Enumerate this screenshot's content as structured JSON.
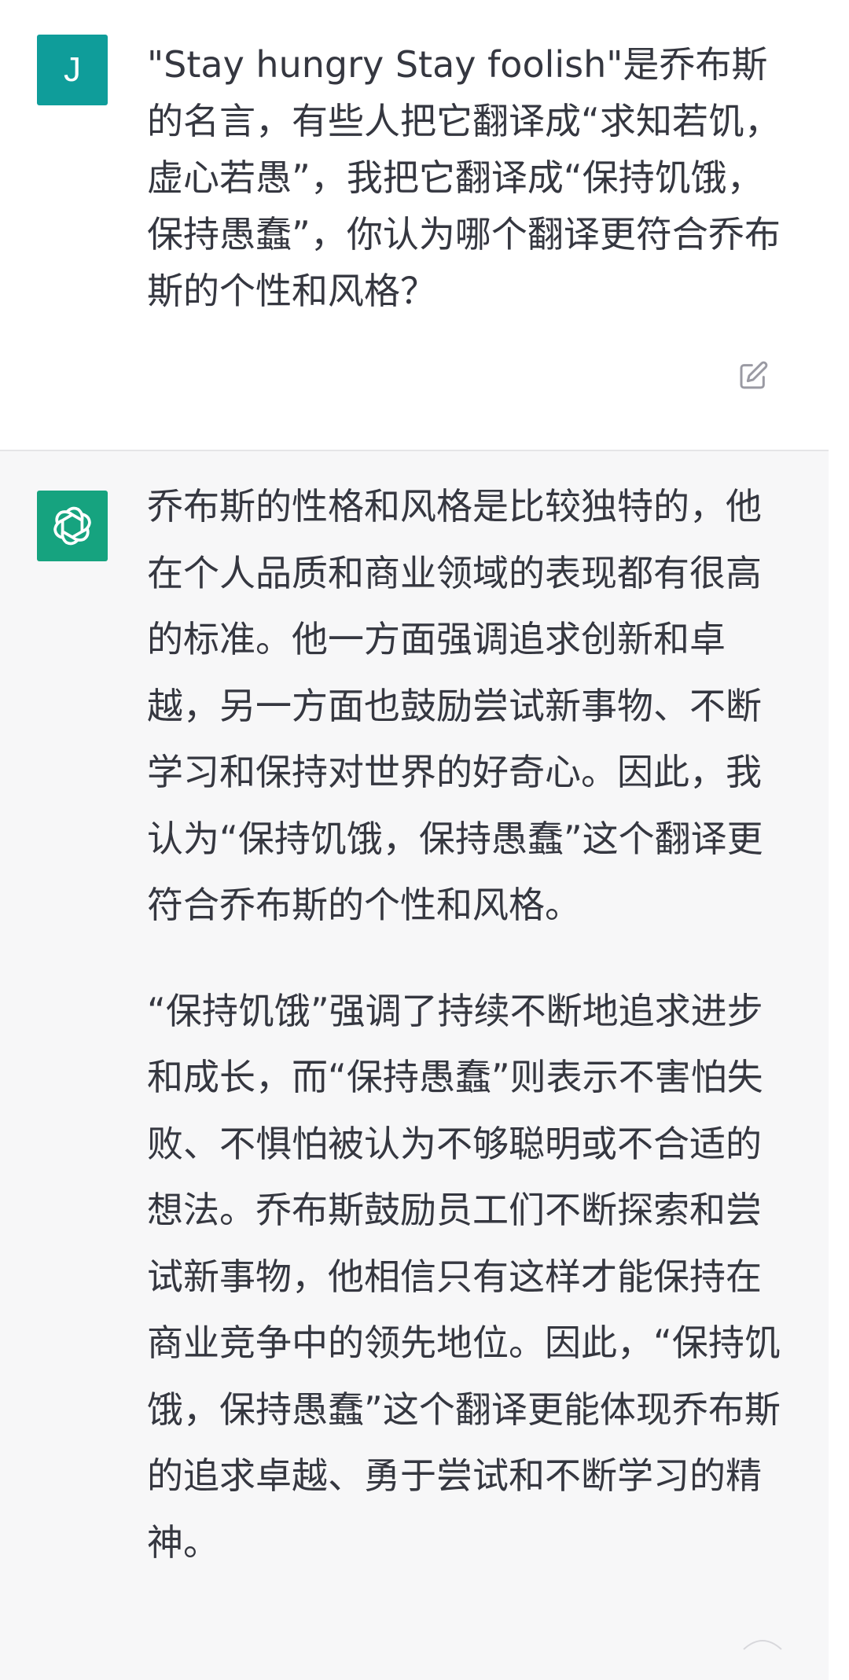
{
  "conversation": {
    "user_message": {
      "avatar_letter": "J",
      "avatar_color": "#0f9d9a",
      "text": "\"Stay hungry Stay foolish\"是乔布斯的名言，有些人把它翻译成“求知若饥，虚心若愚”，我把它翻译成“保持饥饿，保持愚蠢”，你认为哪个翻译更符合乔布斯的个性和风格？",
      "edit_icon": "edit-icon"
    },
    "assistant_message": {
      "avatar_icon": "openai-logo-icon",
      "avatar_color": "#16a37f",
      "paragraphs": [
        "乔布斯的性格和风格是比较独特的，他在个人品质和商业领域的表现都有很高的标准。他一方面强调追求创新和卓越，另一方面也鼓励尝试新事物、不断学习和保持对世界的好奇心。因此，我认为“保持饥饿，保持愚蠢”这个翻译更符合乔布斯的个性和风格。",
        "“保持饥饿”强调了持续不断地追求进步和成长，而“保持愚蠢”则表示不害怕失败、不惧怕被认为不够聪明或不合适的想法。乔布斯鼓励员工们不断探索和尝试新事物，他相信只有这样才能保持在商业竞争中的领先地位。因此，“保持饥饿，保持愚蠢”这个翻译更能体现乔布斯的追求卓越、勇于尝试和不断学习的精神。"
      ]
    }
  },
  "colors": {
    "user_bg": "#ffffff",
    "assistant_bg": "#f7f7f8",
    "text": "#353740",
    "divider": "#e5e5e7"
  }
}
